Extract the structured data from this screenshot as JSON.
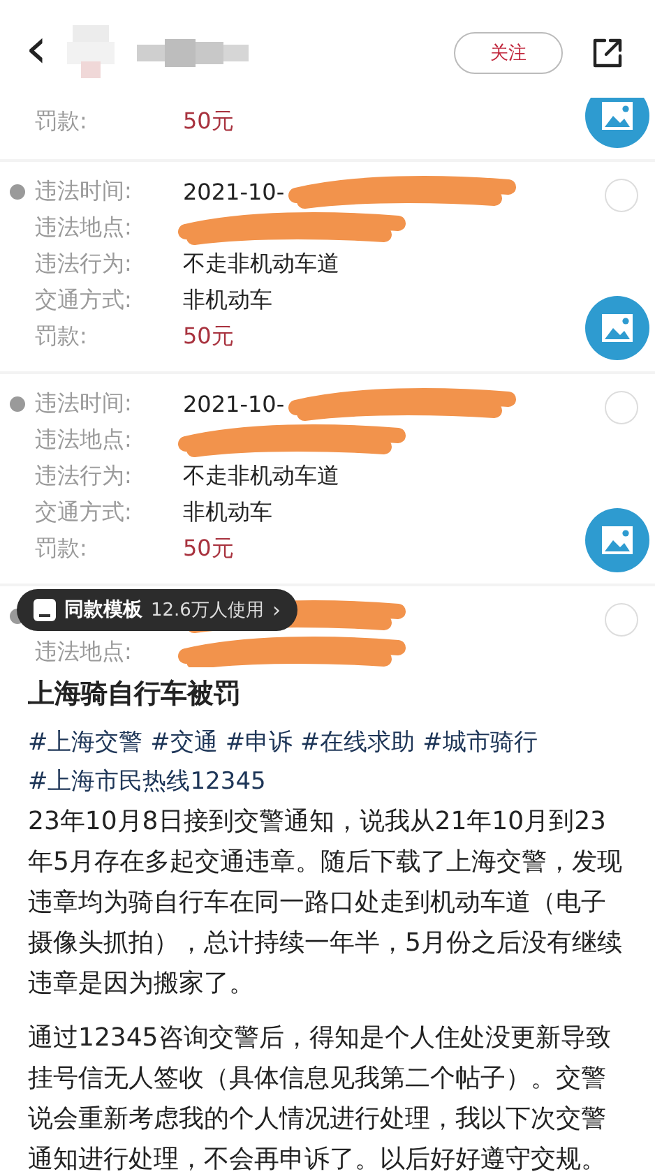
{
  "top_bar": {
    "back": "‹",
    "follow_button": "关注"
  },
  "records": [
    {
      "fields": [
        {
          "kind": "fine",
          "label": "罚款:",
          "value": "50元"
        }
      ],
      "has_photo": true
    },
    {
      "checked": false,
      "has_photo": true,
      "fields": [
        {
          "kind": "text",
          "label": "违法时间:",
          "value": "2021-10-",
          "redacted": true
        },
        {
          "kind": "text",
          "label": "违法地点:",
          "redacted": true
        },
        {
          "kind": "text",
          "label": "违法行为:",
          "value": "不走非机动车道"
        },
        {
          "kind": "text",
          "label": "交通方式:",
          "value": "非机动车"
        },
        {
          "kind": "fine",
          "label": "罚款:",
          "value": "50元"
        }
      ]
    },
    {
      "checked": false,
      "has_photo": true,
      "fields": [
        {
          "kind": "text",
          "label": "违法时间:",
          "value": "2021-10-",
          "redacted": true
        },
        {
          "kind": "text",
          "label": "违法地点:",
          "redacted": true
        },
        {
          "kind": "text",
          "label": "违法行为:",
          "value": "不走非机动车道"
        },
        {
          "kind": "text",
          "label": "交通方式:",
          "value": "非机动车"
        },
        {
          "kind": "fine",
          "label": "罚款:",
          "value": "50元"
        }
      ]
    },
    {
      "checked": false,
      "has_photo": false,
      "fields": [
        {
          "kind": "text",
          "redacted": true
        },
        {
          "kind": "text",
          "label": "违法地点:",
          "redacted": true
        }
      ]
    }
  ],
  "template_badge": {
    "label": "同款模板",
    "usage": "12.6万人使用",
    "chevron": "›"
  },
  "post": {
    "title": "上海骑自行车被罚",
    "tags": [
      "#上海交警",
      "#交通",
      "#申诉",
      "#在线求助",
      "#城市骑行",
      "#上海市民热线12345"
    ],
    "paragraphs": [
      "23年10月8日接到交警通知，说我从21年10月到23年5月存在多起交通违章。随后下载了上海交警，发现违章均为骑自行车在同一路口处走到机动车道（电子摄像头抓拍），总计持续一年半，5月份之后没有继续违章是因为搬家了。",
      "通过12345咨询交警后，得知是个人住处没更新导致挂号信无人签收（具体信息见我第二个帖子）。交警说会重新考虑我的个人情况进行处理，我以下次交警通知进行处理，不会再申诉了。以后好好遵守交规。"
    ]
  }
}
